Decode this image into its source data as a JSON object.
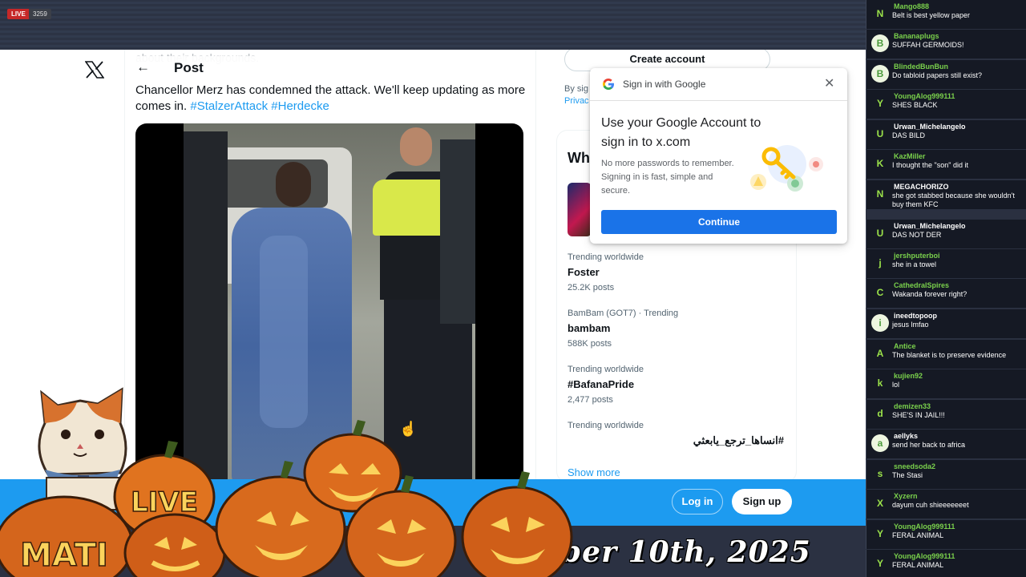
{
  "stream": {
    "live_label": "LIVE",
    "viewer_count": "3259",
    "date_banner": "ber 10th, 2025"
  },
  "post": {
    "faded_text": "about their backgrounds.",
    "header_title": "Post",
    "text_main": "Chancellor Merz has condemned the attack. We'll keep updating as more comes in.",
    "hashtags": [
      "#StalzerAttack",
      "#Herdecke"
    ]
  },
  "sidebar": {
    "create_account": "Create account",
    "legal_line1": "By sig",
    "legal_line2": "Privac",
    "whats_happening": "Wh",
    "trends": [
      {
        "context": "Trending worldwide",
        "name": "Foster",
        "count": "25.2K posts"
      },
      {
        "context": "BamBam (GOT7) · Trending",
        "name": "bambam",
        "count": "588K posts"
      },
      {
        "context": "Trending worldwide",
        "name": "#BafanaPride",
        "count": "2,477 posts"
      },
      {
        "context": "Trending worldwide",
        "name": "#انساها_ترجع_يابعثي",
        "count": ""
      }
    ],
    "show_more": "Show more"
  },
  "google_popup": {
    "header": "Sign in with Google",
    "title": "Use your Google Account to sign in to x.com",
    "description": "No more passwords to remember. Signing in is fast, simple and secure.",
    "continue": "Continue"
  },
  "bottom_bar": {
    "login": "Log in",
    "signup": "Sign up"
  },
  "overlay": {
    "sign_line1": "LIVE",
    "sign_line2": "MATI"
  },
  "chat": [
    {
      "avatar": "N",
      "user": "Mango888",
      "text": "Belt is best yellow paper"
    },
    {
      "avatar": "B",
      "user": "Bananaplugs",
      "text": "SUFFAH GERMOIDS!",
      "style": "light"
    },
    {
      "avatar": "B",
      "user": "BlindedBunBun",
      "text": "Do tabloid papers still exist?",
      "style": "light"
    },
    {
      "avatar": "Y",
      "user": "YoungAlog999111",
      "text": "SHES BLACK"
    },
    {
      "avatar": "U",
      "user": "Urwan_Michelangelo",
      "text": "DAS BILD",
      "white": true
    },
    {
      "avatar": "K",
      "user": "KazMiller",
      "text": "I thought the \"son\" did it"
    },
    {
      "avatar": "N",
      "user": "MEGACHORIZO",
      "text": "she got stabbed because she wouldn't buy them KFC",
      "white": true
    },
    {
      "avatar": "U",
      "user": "Urwan_Michelangelo",
      "text": "DAS NOT DER",
      "white": true
    },
    {
      "avatar": "j",
      "user": "jershputerboi",
      "text": "she in a towel"
    },
    {
      "avatar": "C",
      "user": "CathedralSpires",
      "text": "Wakanda forever right?"
    },
    {
      "avatar": "i",
      "user": "ineedtopoop",
      "text": "jesus lmfao",
      "white": true,
      "style": "light"
    },
    {
      "avatar": "A",
      "user": "Antice",
      "text": "The blanket is to preserve evidence"
    },
    {
      "avatar": "k",
      "user": "kujien92",
      "text": "lol"
    },
    {
      "avatar": "d",
      "user": "demizen33",
      "text": "SHE'S IN JAIL!!!"
    },
    {
      "avatar": "a",
      "user": "aellyks",
      "text": "send her back to africa",
      "white": true,
      "style": "light"
    },
    {
      "avatar": "s",
      "user": "sneedsoda2",
      "text": "The Stasi"
    },
    {
      "avatar": "X",
      "user": "Xyzern",
      "text": "dayum cuh shieeeeeeet"
    },
    {
      "avatar": "Y",
      "user": "YoungAlog999111",
      "text": "FERAL ANIMAL"
    },
    {
      "avatar": "Y",
      "user": "YoungAlog999111",
      "text": "FERAL ANIMAL"
    }
  ],
  "colors": {
    "x_blue": "#1d9bf0",
    "google_blue": "#1a73e8",
    "live_red": "#c62828",
    "chat_name_green": "#7ad14c"
  },
  "icons": [
    "x-logo-icon",
    "back-arrow-icon",
    "google-g-icon",
    "close-icon",
    "cursor-icon",
    "key-illustration"
  ]
}
